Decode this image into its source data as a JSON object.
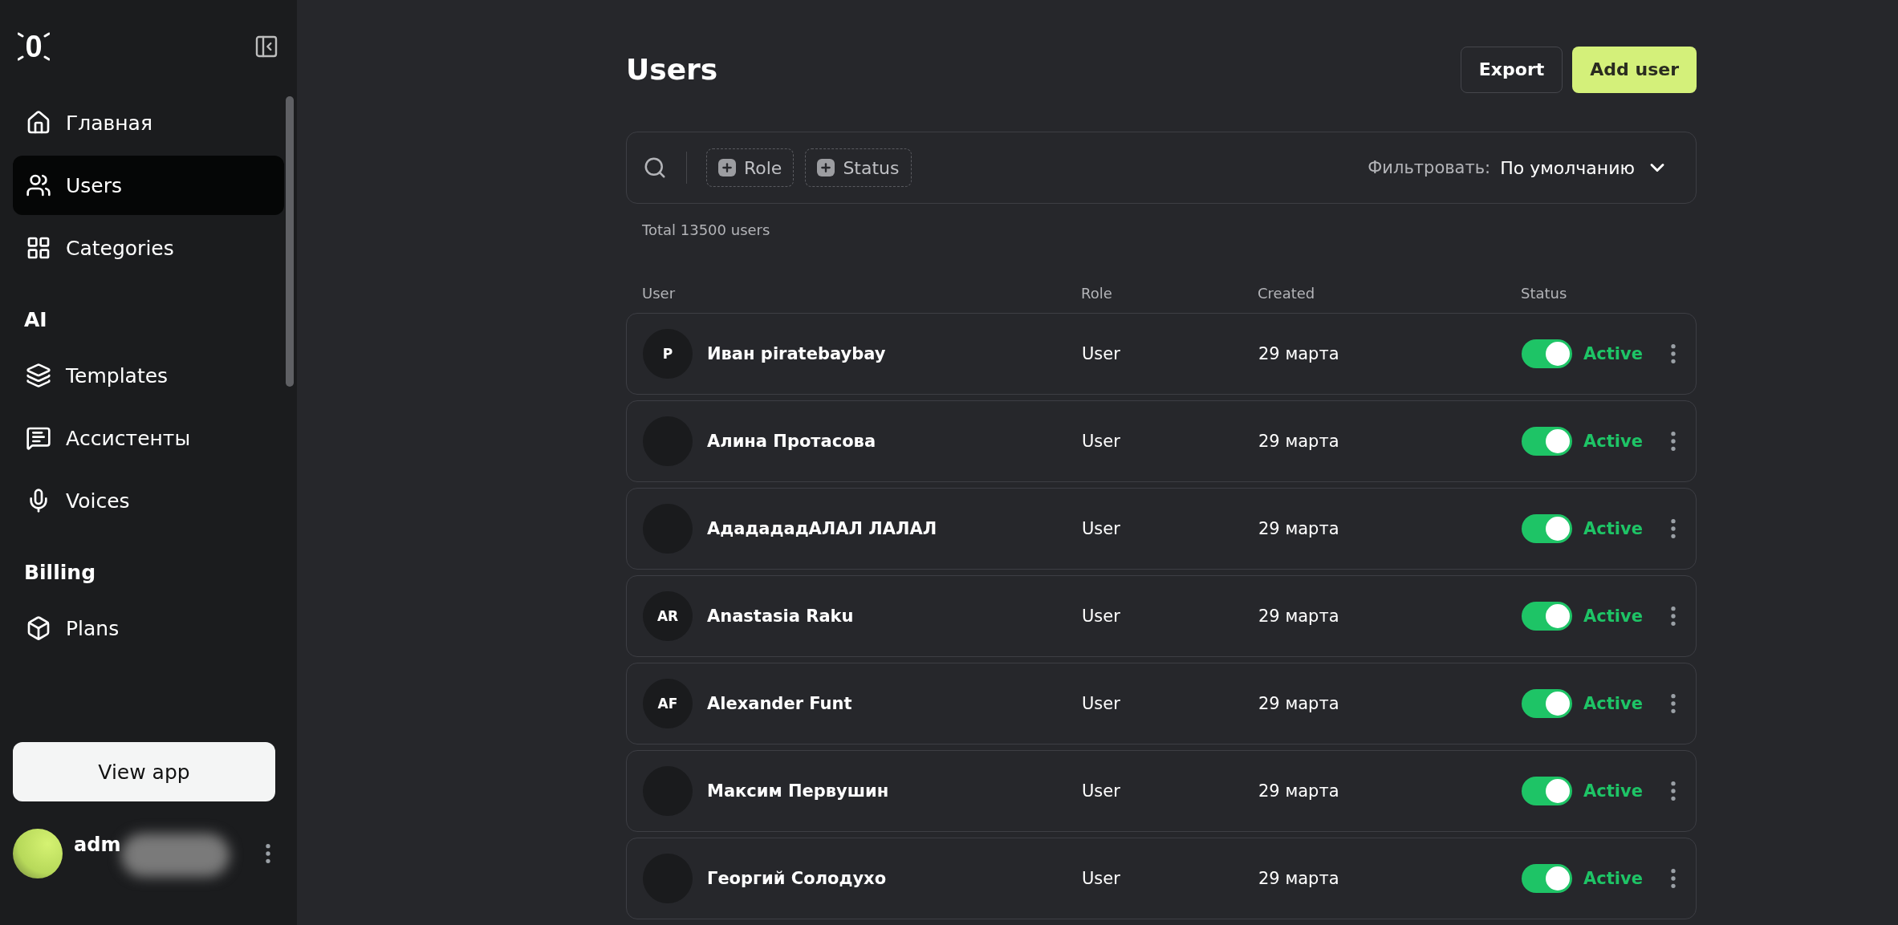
{
  "sidebar": {
    "logo": "0",
    "sections": [
      {
        "items": [
          {
            "label": "Главная",
            "kind": "home",
            "selected": false
          },
          {
            "label": "Users",
            "kind": "users",
            "selected": true
          },
          {
            "label": "Categories",
            "kind": "grid",
            "selected": false
          }
        ]
      },
      {
        "title": "AI",
        "items": [
          {
            "label": "Templates",
            "kind": "layers",
            "selected": false
          },
          {
            "label": "Ассистенты",
            "kind": "chat",
            "selected": false
          },
          {
            "label": "Voices",
            "kind": "mic",
            "selected": false
          }
        ]
      },
      {
        "title": "Billing",
        "items": [
          {
            "label": "Plans",
            "kind": "box",
            "selected": false
          }
        ]
      }
    ],
    "view_app_button": "View app",
    "account": {
      "name": "adm"
    }
  },
  "page": {
    "title": "Users",
    "buttons": [
      {
        "label": "Export",
        "kind": "outline"
      },
      {
        "label": "Add user",
        "kind": "primary"
      }
    ],
    "filters": {
      "chips": [
        "Role",
        "Status"
      ],
      "sort_label": "Фильтровать:",
      "sort_value": "По умолчанию"
    },
    "total": "Total 13500 users"
  },
  "table": {
    "columns": [
      "User",
      "Role",
      "Created",
      "Status"
    ],
    "rows": [
      {
        "initials": "P",
        "name": "Иван piratebaybay",
        "role": "User",
        "created": "29 марта",
        "on": true,
        "status": "Active"
      },
      {
        "name": "Алина Протасова",
        "role": "User",
        "created": "29 марта",
        "on": true,
        "status": "Active"
      },
      {
        "name": "АдадададАЛАЛ ЛАЛАЛ",
        "role": "User",
        "created": "29 марта",
        "on": true,
        "status": "Active"
      },
      {
        "initials": "AR",
        "name": "Anastasia Raku",
        "role": "User",
        "created": "29 марта",
        "on": true,
        "status": "Active"
      },
      {
        "initials": "AF",
        "name": "Alexander Funt",
        "role": "User",
        "created": "29 марта",
        "on": true,
        "status": "Active"
      },
      {
        "name": "Максим Первушин",
        "role": "User",
        "created": "29 марта",
        "on": true,
        "status": "Active"
      },
      {
        "name": "Георгий Солодухо",
        "role": "User",
        "created": "29 марта",
        "on": true,
        "status": "Active"
      }
    ]
  }
}
